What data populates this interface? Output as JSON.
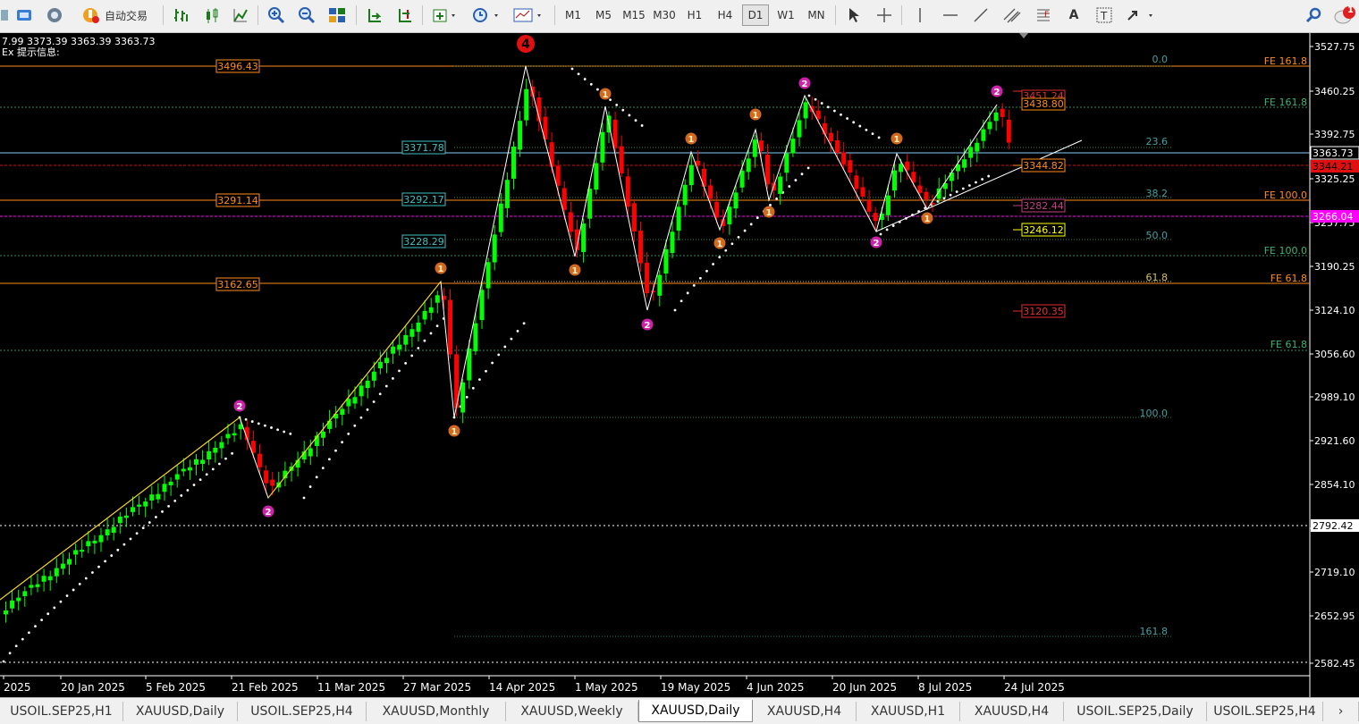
{
  "toolbar": {
    "auto_trade_label": "自动交易",
    "timeframes": [
      "M1",
      "M5",
      "M15",
      "M30",
      "H1",
      "H4",
      "D1",
      "W1",
      "MN"
    ],
    "active_timeframe": "D1",
    "notification_count": "1"
  },
  "chart": {
    "info_ohlc": "7.99 3373.39 3363.39 3363.73",
    "info_tip": "Ex 提示信息:",
    "info_side_digits": [
      "2",
      "",
      "7",
      "",
      "2",
      "4",
      "2",
      "5"
    ],
    "wave_label_top": "4",
    "price_axis": [
      "3527.75",
      "3460.25",
      "3392.75",
      "3325.25",
      "3257.75",
      "3190.25",
      "3124.10",
      "3056.60",
      "2989.10",
      "2921.60",
      "2854.10",
      "2786.60",
      "2719.10",
      "2652.95",
      "2582.45"
    ],
    "date_axis": [
      "2025",
      "20 Jan 2025",
      "5 Feb 2025",
      "21 Feb 2025",
      "11 Mar 2025",
      "27 Mar 2025",
      "14 Apr 2025",
      "1 May 2025",
      "19 May 2025",
      "4 Jun 2025",
      "20 Jun 2025",
      "8 Jul 2025",
      "24 Jul 2025"
    ],
    "current_price": "3363.73",
    "red_line_price": "3344.21",
    "magenta_line_price": "3266.04",
    "dashed_line_price": "2792.42",
    "left_labels": [
      "3496.43",
      "3291.14",
      "3162.65"
    ],
    "mid_labels": [
      "3371.78",
      "3292.17",
      "3228.29"
    ],
    "right_labels": {
      "top1": "3451.24",
      "top2": "3438.80",
      "l3344": "3344.82",
      "l3282": "3282.44",
      "l3246": "3246.12",
      "l3120": "3120.35"
    },
    "fib_levels": [
      "0.0",
      "23.6",
      "38.2",
      "50.0",
      "61.8",
      "100.0",
      "161.8"
    ],
    "fe_labels": [
      "FE 161.8",
      "FE 161.8",
      "FE 100.0",
      "FE 100.0",
      "FE 61.8",
      "FE 61.8"
    ],
    "colors": {
      "up": "#00ff00",
      "down": "#ff0000",
      "orange_marker": "#d2691e",
      "magenta_marker": "#cc22aa"
    }
  },
  "tabs": [
    "USOIL.SEP25,H1",
    "XAUUSD,Daily",
    "USOIL.SEP25,H4",
    "XAUUSD,Monthly",
    "XAUUSD,Weekly",
    "XAUUSD,Daily",
    "XAUUSD,H4",
    "XAUUSD,H1",
    "XAUUSD,H4",
    "USOIL.SEP25,Daily",
    "USOIL.SEP25,H4"
  ],
  "active_tab_index": 5
}
